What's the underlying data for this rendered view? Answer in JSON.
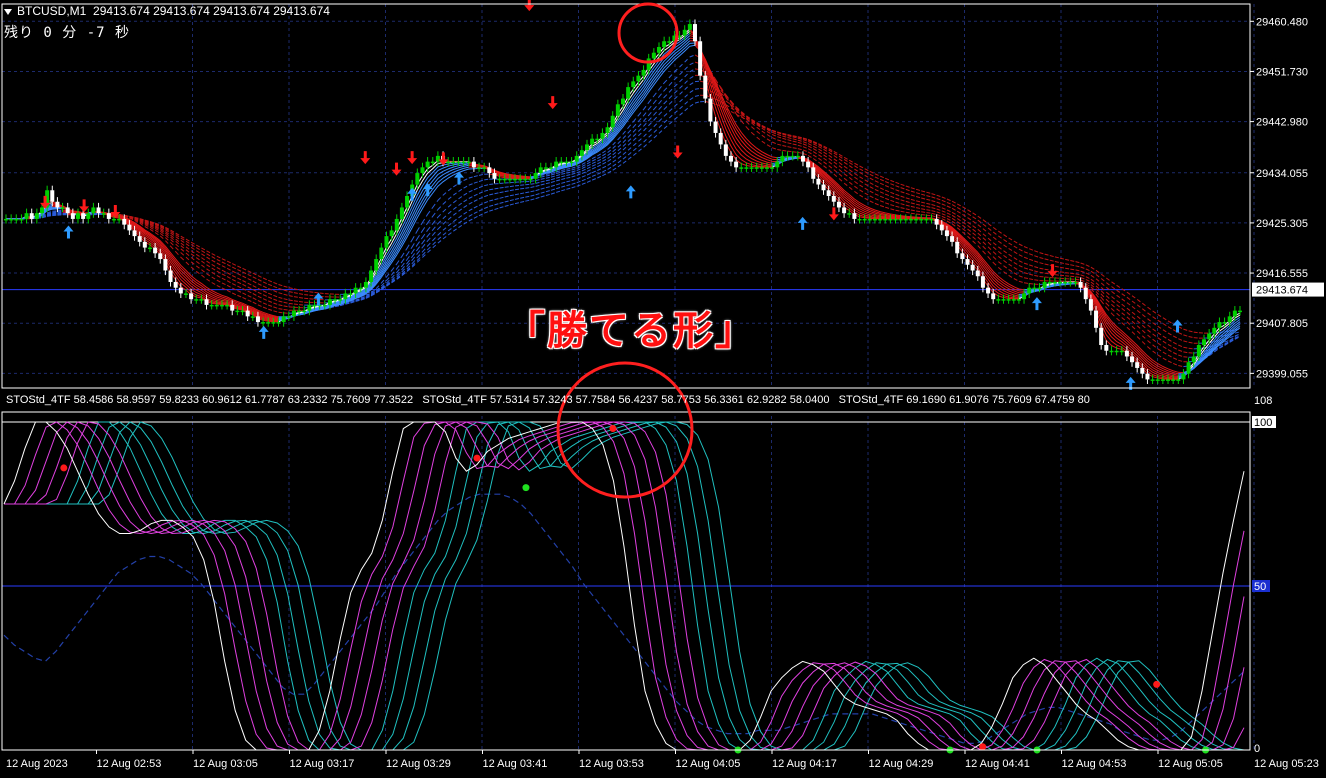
{
  "header": {
    "symbol": "BTCUSD,M1",
    "ohlc": "29413.674 29413.674 29413.674 29413.674",
    "timer": "残り 0 分 -7 秒"
  },
  "overlay": {
    "caption": "「勝てる形」"
  },
  "colors": {
    "background": "#000000",
    "grid": "#1c2a6b",
    "axis": "#ffffff",
    "bull_candle": "#00d000",
    "bear_candle": "#ffffff",
    "ribbon_blue": "#3b8cff",
    "ribbon_red": "#e01818",
    "arrow_up": "#2e9bff",
    "arrow_down": "#ff1a1a",
    "stoch_magenta": "#e040e0",
    "stoch_teal": "#20c0c0",
    "circle": "#ff1f1f",
    "current_price_line": "#2a3cff"
  },
  "indicator_header": {
    "part1": "STOStd_4TF 58.4586 58.9597 59.8233 60.9612 61.7787 63.2332 75.7609 77.3522",
    "part2": "STOStd_4TF 57.5314 57.3243 57.7584 56.4237 58.7753 56.3361 62.9282 58.0400",
    "part3": "STOStd_4TF 69.1690 61.9076 75.7609 67.4759 80"
  },
  "chart_data": [
    {
      "type": "candlestick",
      "title": "BTCUSD,M1",
      "y_ticks": [
        "29460.480",
        "29451.730",
        "29442.980",
        "29434.055",
        "29425.305",
        "29416.555",
        "29407.805",
        "29399.055"
      ],
      "ylim": [
        29396.5,
        29463.5
      ],
      "current_price": "29413.674",
      "x_ticks": [
        "12 Aug 2023",
        "12 Aug 02:53",
        "12 Aug 03:05",
        "12 Aug 03:17",
        "12 Aug 03:29",
        "12 Aug 03:41",
        "12 Aug 03:53",
        "12 Aug 04:05",
        "12 Aug 04:17",
        "12 Aug 04:29",
        "12 Aug 04:41",
        "12 Aug 04:53",
        "12 Aug 05:05",
        "12 Aug 05:23"
      ],
      "close": [
        29426,
        29426,
        29426,
        29426,
        29427,
        29426,
        29427,
        29428,
        29431,
        29429,
        29428,
        29428,
        29427,
        29426,
        29427,
        29426,
        29427,
        29428,
        29427,
        29427,
        29426,
        29426,
        29426,
        29425,
        29424,
        29423,
        29422,
        29421,
        29421,
        29420,
        29419,
        29417,
        29415,
        29414,
        29413,
        29413,
        29412,
        29412,
        29412,
        29411,
        29411,
        29411,
        29411,
        29411,
        29410,
        29410,
        29410,
        29409,
        29409,
        29408,
        29408,
        29408,
        29408,
        29408,
        29409,
        29409,
        29410,
        29410,
        29410,
        29411,
        29411,
        29411,
        29411,
        29412,
        29412,
        29412,
        29413,
        29413,
        29414,
        29414,
        29415,
        29417,
        29419,
        29421,
        29423,
        29424,
        29426,
        29428,
        29430,
        29432,
        29434,
        29435,
        29436,
        29436,
        29437,
        29436,
        29436,
        29436,
        29436,
        29436,
        29436,
        29435,
        29435,
        29435,
        29434,
        29433,
        29433,
        29433,
        29433,
        29433,
        29433,
        29433,
        29433,
        29434,
        29435,
        29435,
        29435,
        29436,
        29436,
        29436,
        29436,
        29437,
        29438,
        29439,
        29440,
        29440,
        29441,
        29442,
        29444,
        29446,
        29447,
        29449,
        29450,
        29451,
        29452,
        29454,
        29455,
        29456,
        29457,
        29457,
        29458,
        29458,
        29459,
        29460,
        29457,
        29451,
        29447,
        29443,
        29441,
        29439,
        29437,
        29436,
        29435,
        29435,
        29435,
        29435,
        29435,
        29435,
        29435,
        29435,
        29436,
        29437,
        29437,
        29437,
        29437,
        29436,
        29435,
        29433,
        29432,
        29431,
        29430,
        29429,
        29428,
        29427,
        29427,
        29426,
        29426,
        29426,
        29426,
        29426,
        29426,
        29426,
        29426,
        29426,
        29426,
        29426,
        29426,
        29426,
        29426,
        29426,
        29426,
        29425,
        29424,
        29423,
        29422,
        29420,
        29419,
        29418,
        29417,
        29416,
        29414,
        29413,
        29412,
        29412,
        29412,
        29412,
        29412,
        29412,
        29413,
        29414,
        29414,
        29414,
        29415,
        29415,
        29415,
        29415,
        29415,
        29415,
        29415,
        29414,
        29412,
        29410,
        29407,
        29404,
        29403,
        29403,
        29403,
        29403,
        29402,
        29401,
        29400,
        29399,
        29398,
        29398,
        29398,
        29398,
        29398,
        29398,
        29398,
        29399,
        29401,
        29402,
        29404,
        29405,
        29406,
        29407,
        29408,
        29408,
        29409,
        29410,
        29410
      ],
      "markers": {
        "up_arrows": [
          {
            "time": "02:49",
            "price": 29423.8
          },
          {
            "time": "03:14",
            "price": 29406.3
          },
          {
            "time": "03:21",
            "price": 29412.1
          },
          {
            "time": "03:33",
            "price": 29430.4
          },
          {
            "time": "03:35",
            "price": 29431.2
          },
          {
            "time": "03:39",
            "price": 29433.2
          },
          {
            "time": "04:01",
            "price": 29430.8
          },
          {
            "time": "04:23",
            "price": 29425.3
          },
          {
            "time": "04:53",
            "price": 29411.3
          },
          {
            "time": "05:05",
            "price": 29397.4
          },
          {
            "time": "05:11",
            "price": 29407.4
          }
        ],
        "down_arrows": [
          {
            "time": "02:46",
            "price": 29428.8
          },
          {
            "time": "02:51",
            "price": 29428.2
          },
          {
            "time": "02:55",
            "price": 29427.2
          },
          {
            "time": "03:27",
            "price": 29436.6
          },
          {
            "time": "03:31",
            "price": 29434.6
          },
          {
            "time": "03:33",
            "price": 29436.6
          },
          {
            "time": "03:37",
            "price": 29436.4
          },
          {
            "time": "03:48",
            "price": 29463.3
          },
          {
            "time": "03:51",
            "price": 29446.2
          },
          {
            "time": "04:07",
            "price": 29437.6
          },
          {
            "time": "04:27",
            "price": 29426.8
          },
          {
            "time": "04:55",
            "price": 29416.9
          }
        ]
      },
      "grid": true
    },
    {
      "type": "line",
      "title": "STOStd_4TF",
      "y_ticks": [
        "108",
        "100",
        "50",
        "0"
      ],
      "ylim": [
        0,
        108
      ],
      "level_line": 50,
      "series": [
        {
          "values": [
            75,
            80,
            90,
            99,
            100,
            98,
            94,
            90,
            84,
            79,
            75,
            72,
            70,
            69,
            69,
            69,
            69,
            69,
            67,
            63,
            53,
            40,
            25,
            8,
            3,
            0,
            0,
            0,
            0,
            2,
            8,
            18,
            30,
            42,
            50,
            56,
            62,
            74,
            90,
            98,
            100,
            100,
            98,
            93,
            88,
            88,
            90,
            92,
            93,
            94,
            96,
            97,
            98,
            99,
            100,
            100,
            100,
            99,
            95,
            80,
            59,
            39,
            25,
            14,
            7,
            0,
            0,
            0,
            0,
            0,
            2,
            5,
            10,
            16,
            20,
            22,
            25,
            25,
            23,
            20,
            17,
            15,
            14,
            14,
            13,
            12,
            11,
            10,
            5,
            2,
            1,
            1,
            1,
            0,
            2,
            5,
            10,
            17,
            23,
            25,
            25,
            23,
            20,
            16,
            15,
            14,
            12,
            10,
            8,
            5,
            2,
            1,
            0,
            0,
            0,
            12,
            28,
            45,
            60,
            72,
            80
          ]
        },
        {
          "values": [
            62,
            66,
            72,
            78,
            83,
            85,
            85,
            83,
            79,
            74,
            71,
            69,
            68,
            68,
            68,
            69,
            68,
            66,
            62,
            54,
            43,
            30,
            17,
            8,
            3,
            1,
            0,
            0,
            1,
            5,
            13,
            23,
            34,
            45,
            53,
            60,
            70,
            82,
            91,
            96,
            97,
            96,
            93,
            89,
            87,
            88,
            90,
            92,
            93,
            94,
            95,
            96,
            97,
            98,
            98,
            98,
            95,
            86,
            70,
            52,
            35,
            22,
            13,
            7,
            3,
            1,
            0,
            0,
            1,
            3,
            6,
            10,
            15,
            19,
            21,
            23,
            23,
            22,
            20,
            17,
            15,
            14,
            13,
            13,
            12,
            11,
            9,
            6,
            3,
            1,
            1,
            1,
            1,
            2,
            5,
            10,
            16,
            21,
            23,
            23,
            21,
            18,
            15,
            14,
            13,
            11,
            9,
            7,
            4,
            2,
            1,
            0,
            0,
            1,
            8,
            20,
            35,
            50,
            62,
            71
          ]
        },
        {
          "values": [
            50,
            54,
            60,
            66,
            71,
            74,
            75,
            74,
            71,
            68,
            66,
            65,
            65,
            65,
            65,
            65,
            64,
            60,
            53,
            44,
            34,
            23,
            14,
            7,
            3,
            1,
            1,
            2,
            5,
            12,
            21,
            32,
            42,
            50,
            57,
            66,
            76,
            85,
            90,
            93,
            93,
            91,
            88,
            86,
            86,
            88,
            90,
            92,
            93,
            94,
            95,
            96,
            97,
            97,
            96,
            91,
            80,
            64,
            47,
            32,
            20,
            12,
            7,
            3,
            2,
            1,
            1,
            1,
            3,
            6,
            10,
            14,
            17,
            20,
            21,
            21,
            20,
            18,
            16,
            14,
            13,
            12,
            12,
            12,
            11,
            9,
            6,
            3,
            2,
            1,
            1,
            1,
            2,
            4,
            9,
            14,
            19,
            21,
            21,
            20,
            17,
            15,
            13,
            12,
            10,
            8,
            6,
            3,
            2,
            1,
            1,
            1,
            2,
            6,
            15,
            28,
            42,
            54,
            63
          ]
        }
      ],
      "signal_series": {
        "name": "main",
        "values": [
          75,
          82,
          92,
          100,
          100,
          97,
          92,
          85,
          78,
          72,
          68,
          66,
          66,
          67,
          69,
          70,
          70,
          68,
          65,
          58,
          45,
          27,
          12,
          3,
          0,
          0,
          0,
          0,
          0,
          0,
          6,
          18,
          34,
          48,
          55,
          60,
          70,
          85,
          98,
          100,
          100,
          100,
          97,
          89,
          85,
          87,
          91,
          93,
          95,
          96,
          97,
          98,
          99,
          100,
          100,
          100,
          98,
          93,
          82,
          62,
          38,
          18,
          8,
          2,
          0,
          0,
          0,
          0,
          0,
          0,
          0,
          3,
          10,
          18,
          22,
          25,
          27,
          26,
          24,
          20,
          16,
          14,
          13,
          12,
          11,
          9,
          5,
          2,
          0,
          0,
          0,
          0,
          0,
          2,
          7,
          14,
          22,
          26,
          28,
          26,
          22,
          18,
          14,
          11,
          9,
          6,
          3,
          1,
          0,
          0,
          0,
          0,
          0,
          4,
          18,
          36,
          54,
          70,
          85
        ]
      },
      "slow_series_values": [
        35,
        32,
        30,
        28,
        27,
        30,
        34,
        38,
        42,
        46,
        50,
        54,
        56,
        58,
        59,
        59,
        58,
        56,
        54,
        51,
        47,
        43,
        39,
        35,
        31,
        27,
        23,
        19,
        17,
        17,
        20,
        24,
        28,
        32,
        36,
        40,
        44,
        49,
        54,
        58,
        62,
        66,
        70,
        73,
        75,
        77,
        78,
        78,
        78,
        77,
        75,
        72,
        68,
        64,
        60,
        56,
        51,
        47,
        43,
        39,
        35,
        31,
        27,
        23,
        19,
        15,
        12,
        9,
        7,
        6,
        5,
        5,
        5,
        6,
        6,
        6,
        7,
        8,
        9,
        10,
        11,
        11,
        11,
        11,
        11,
        10,
        9,
        8,
        7,
        6,
        5,
        4,
        3,
        2,
        2,
        3,
        5,
        7,
        9,
        11,
        12,
        13,
        13,
        12,
        11,
        10,
        9,
        8,
        6,
        5,
        4,
        3,
        3,
        4,
        6,
        9,
        12,
        15,
        18,
        21,
        24
      ],
      "markers": {
        "red_dots": [
          {
            "index": 11,
            "value": 86
          },
          {
            "index": 87,
            "value": 89
          },
          {
            "index": 112,
            "value": 98
          },
          {
            "index": 180,
            "value": 1
          },
          {
            "index": 212,
            "value": 20
          }
        ],
        "green_dots": [
          {
            "index": 96,
            "value": 80
          },
          {
            "index": 135,
            "value": 0
          },
          {
            "index": 174,
            "value": 0
          },
          {
            "index": 190,
            "value": 0
          },
          {
            "index": 221,
            "value": 0
          }
        ]
      },
      "grid": true
    }
  ]
}
